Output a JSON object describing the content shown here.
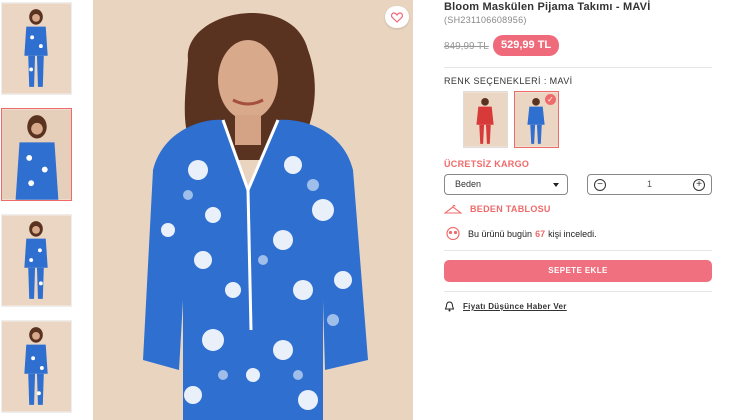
{
  "product": {
    "title": "Bloom Maskülen Pijama Takımı - MAVİ",
    "sku": "(SH231106608956)",
    "old_price": "849,99 TL",
    "new_price": "529,99 TL"
  },
  "colors": {
    "label": "RENK SEÇENEKLERİ : MAVİ",
    "options": [
      "red-floral",
      "blue-floral"
    ],
    "selected": "blue-floral"
  },
  "shipping": "ÜCRETSİZ KARGO",
  "size": {
    "selected": "Beden"
  },
  "quantity": {
    "value": "1",
    "minus": "−",
    "plus": "+"
  },
  "size_chart": "BEDEN TABLOSU",
  "viewed": {
    "prefix": "Bu ürünü bugün",
    "count": "67",
    "suffix": "kişi inceledi."
  },
  "add_to_cart": "SEPETE EKLE",
  "price_alert": "Fiyatı Düşünce Haber Ver",
  "icons": [
    "heart-icon",
    "hanger-icon",
    "eyes-icon",
    "bell-icon",
    "caret-down-icon",
    "check-icon"
  ],
  "theme": {
    "accent": "#ef6a7a",
    "pajama_blue": "#2f6fd0",
    "background_beige": "#e9d4c0"
  }
}
